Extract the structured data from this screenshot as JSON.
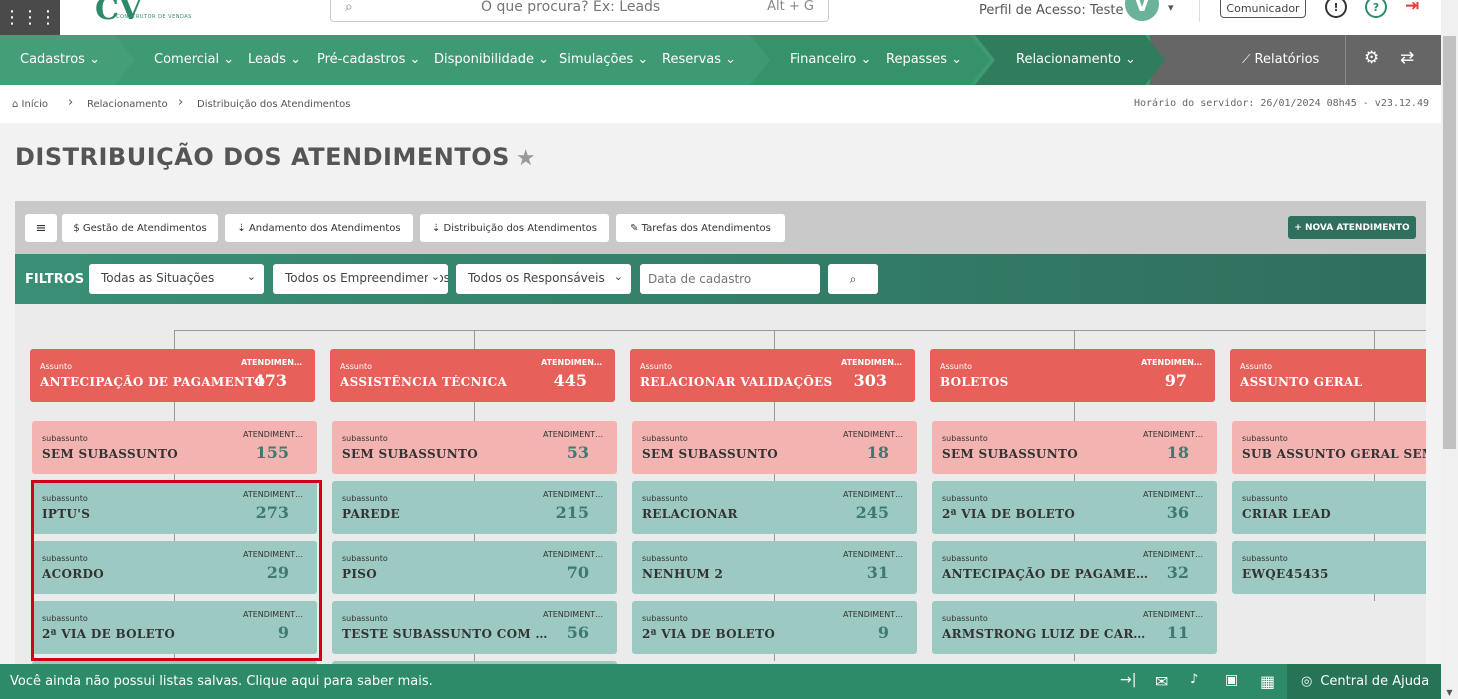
{
  "topbar": {
    "logo": "CV",
    "logo_sub": "CONSTRUTOR DE VENDAS",
    "search_placeholder": "O que procura? Ex: Leads",
    "search_shortcut": "Alt + G",
    "profile": "Perfil de Acesso: Teste",
    "avatar": "V",
    "comunicador": "Comunicador",
    "info_icon": "!",
    "help_icon": "?",
    "logout_icon": "⇥"
  },
  "nav": {
    "items": [
      "Cadastros",
      "Comercial",
      "Leads",
      "Pré-cadastros",
      "Disponibilidade",
      "Simulações",
      "Reservas",
      "Financeiro",
      "Repasses",
      "Relacionamento"
    ],
    "relatorios": "Relatórios",
    "chevron": "⌄",
    "settings_icon": "⚙",
    "swap_icon": "⇄",
    "chart_icon": "📈"
  },
  "breadcrumb": {
    "home": "Início",
    "level1": "Relacionamento",
    "level2": "Distribuição dos Atendimentos",
    "sep": "›",
    "server_time": "Horário do servidor: 26/01/2024 08h45 - v23.12.49"
  },
  "page": {
    "title": "DISTRIBUIÇÃO DOS ATENDIMENTOS",
    "star": "★"
  },
  "toolbar": {
    "menu_icon": "≡",
    "buttons": [
      "$ Gestão de Atendimentos",
      "⇣ Andamento dos Atendimentos",
      "⇣ Distribuição dos Atendimentos",
      "✎ Tarefas dos Atendimentos"
    ],
    "nova": "+ NOVA ATENDIMENTO"
  },
  "filters": {
    "label": "FILTROS",
    "situacao": "Todas as Situações",
    "empreendimento": "Todos os Empreendimentos",
    "responsavel": "Todos os Responsáveis",
    "data_placeholder": "Data de cadastro",
    "caret": "⌄",
    "search_icon": "🔍"
  },
  "tree": {
    "assunto_label": "Assunto",
    "subassunto_label": "subassunto",
    "atend_label": "ATENDIMENTOS",
    "columns": [
      {
        "title": "ANTECIPAÇÃO DE PAGAMENTO",
        "value": "473",
        "subs": [
          {
            "name": "SEM SUBASSUNTO",
            "value": "155"
          },
          {
            "name": "IPTU'S",
            "value": "273"
          },
          {
            "name": "ACORDO",
            "value": "29"
          },
          {
            "name": "2ª VIA DE BOLETO",
            "value": "9"
          }
        ]
      },
      {
        "title": "ASSISTÊNCIA TÉCNICA",
        "value": "445",
        "subs": [
          {
            "name": "SEM SUBASSUNTO",
            "value": "53"
          },
          {
            "name": "PAREDE",
            "value": "215"
          },
          {
            "name": "PISO",
            "value": "70"
          },
          {
            "name": "TESTE SUBASSUNTO COM CARACTERES",
            "value": "56"
          }
        ]
      },
      {
        "title": "RELACIONAR VALIDAÇÕES",
        "value": "303",
        "subs": [
          {
            "name": "SEM SUBASSUNTO",
            "value": "18"
          },
          {
            "name": "RELACIONAR",
            "value": "245"
          },
          {
            "name": "NENHUM 2",
            "value": "31"
          },
          {
            "name": "2ª VIA DE BOLETO",
            "value": "9"
          }
        ]
      },
      {
        "title": "BOLETOS",
        "value": "97",
        "subs": [
          {
            "name": "SEM SUBASSUNTO",
            "value": "18"
          },
          {
            "name": "2ª VIA DE BOLETO",
            "value": "36"
          },
          {
            "name": "ANTECIPAÇÃO DE PAGAMENTO",
            "value": "32"
          },
          {
            "name": "ARMSTRONG LUIZ DE CARVALHO",
            "value": "11"
          }
        ]
      },
      {
        "title": "ASSUNTO GERAL",
        "value": "",
        "subs": [
          {
            "name": "SUB ASSUNTO GERAL SEM",
            "value": ""
          },
          {
            "name": "CRIAR LEAD",
            "value": ""
          },
          {
            "name": "EWQE45435",
            "value": ""
          }
        ]
      }
    ]
  },
  "footer": {
    "message": "Você ainda não possui listas salvas. Clique aqui para saber mais.",
    "help": "Central de Ajuda",
    "icons": [
      "→|",
      "✉",
      "🔔",
      "📅",
      "▦"
    ],
    "chat_icon": "💬"
  },
  "colors": {
    "primary": "#3d9a72",
    "assunto": "#e8605a",
    "sem_sub": "#f2b3b1",
    "sub": "#9dc9c3",
    "highlight": "#d0021b"
  }
}
